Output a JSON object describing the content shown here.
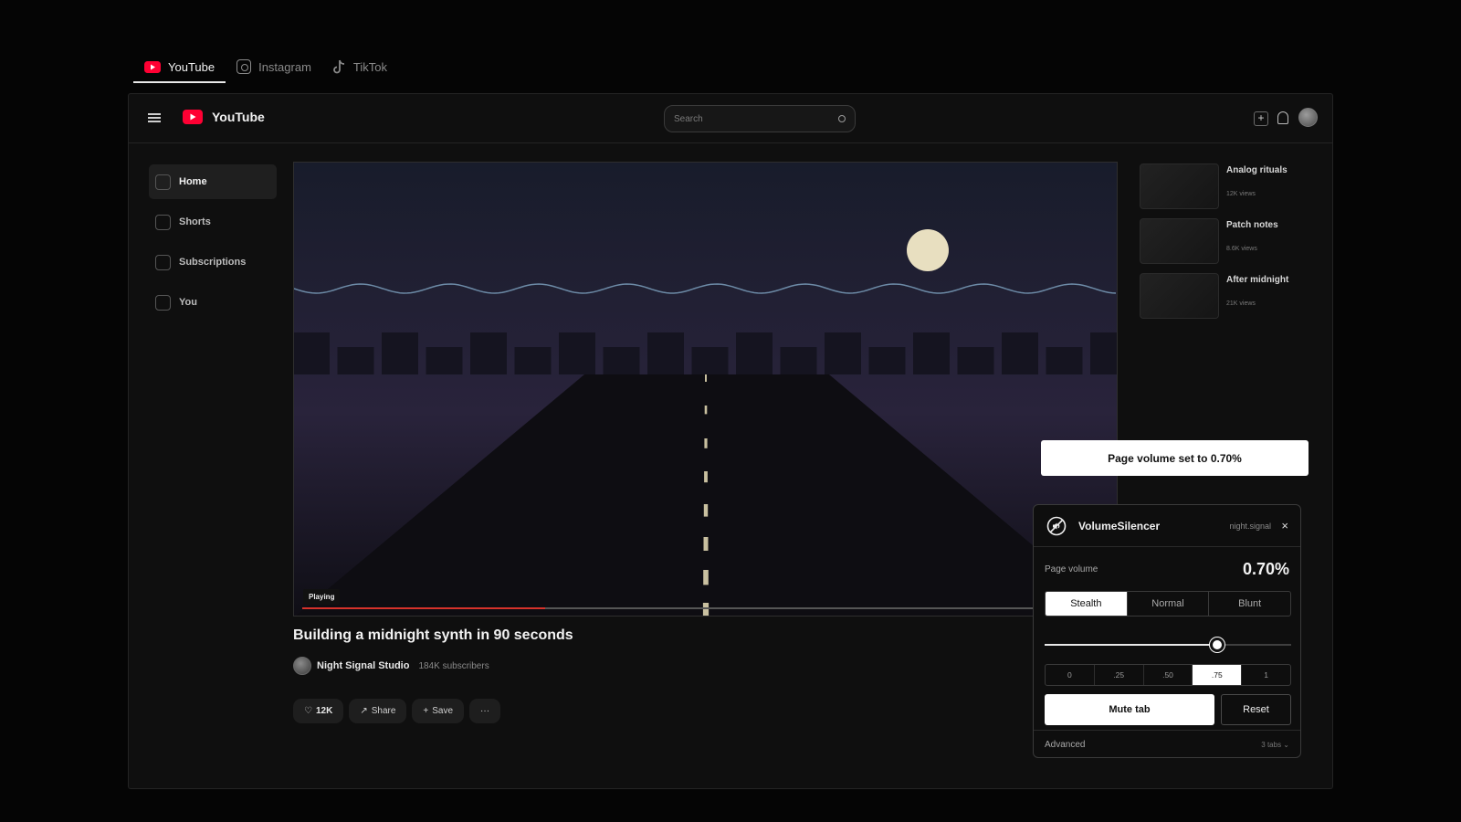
{
  "outer_tabs": [
    {
      "label": "YouTube",
      "icon": "youtube-icon",
      "active": true
    },
    {
      "label": "Instagram",
      "icon": "instagram-icon",
      "active": false
    },
    {
      "label": "TikTok",
      "icon": "tiktok-icon",
      "active": false
    }
  ],
  "header": {
    "brand": "YouTube",
    "search_placeholder": "Search"
  },
  "sidebar": {
    "items": [
      {
        "label": "Home",
        "active": true
      },
      {
        "label": "Shorts",
        "active": false
      },
      {
        "label": "Subscriptions",
        "active": false
      },
      {
        "label": "You",
        "active": false
      }
    ]
  },
  "video": {
    "status": "Playing",
    "progress": 0.3,
    "title": "Building a midnight synth in 90 seconds",
    "channel": "Night Signal Studio",
    "subscribers": "184K subscribers",
    "likes": "12K",
    "like_icon": "♡",
    "share_label": "Share",
    "share_icon": "↗",
    "save_label": "Save",
    "save_icon": "+",
    "more_label": "···"
  },
  "related": [
    {
      "title": "Analog rituals",
      "views": "12K views"
    },
    {
      "title": "Patch notes",
      "views": "8.6K views"
    },
    {
      "title": "After midnight",
      "views": "21K views"
    }
  ],
  "toast": {
    "message": "Page volume set to 0.70%"
  },
  "extension": {
    "name": "VolumeSilencer",
    "account": "night.signal",
    "close_label": "×",
    "volume_label": "Page volume",
    "volume_value": "0.70%",
    "modes": [
      "Stealth",
      "Normal",
      "Blunt"
    ],
    "active_mode": "Stealth",
    "slider_fraction": 0.7,
    "presets": [
      "0",
      ".25",
      ".50",
      ".75",
      "1"
    ],
    "active_preset": ".75",
    "mute_label": "Mute tab",
    "reset_label": "Reset",
    "advanced_label": "Advanced",
    "tabs_count": "3 tabs ⌄"
  },
  "colors": {
    "youtube_red": "#ff0033",
    "progress_red": "#d6322b",
    "background": "#050505",
    "surface": "#0f0f0f"
  }
}
